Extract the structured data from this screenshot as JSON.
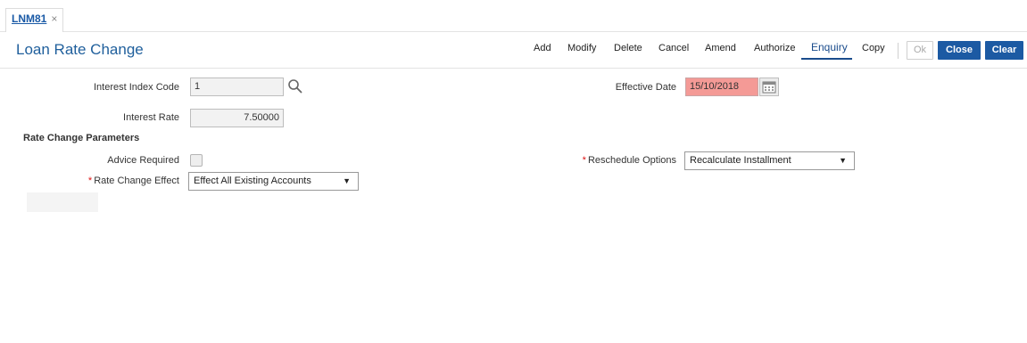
{
  "tab": {
    "label": "LNM81",
    "close": "×"
  },
  "header": {
    "title": "Loan Rate Change"
  },
  "toolbar": {
    "add": "Add",
    "modify": "Modify",
    "delete": "Delete",
    "cancel": "Cancel",
    "amend": "Amend",
    "authorize": "Authorize",
    "enquiry": "Enquiry",
    "copy": "Copy",
    "ok": "Ok",
    "close": "Close",
    "clear": "Clear"
  },
  "form": {
    "interest_index_code": {
      "label": "Interest Index Code",
      "value": "1"
    },
    "effective_date": {
      "label": "Effective Date",
      "value": "15/10/2018"
    },
    "interest_rate": {
      "label": "Interest Rate",
      "value": "7.50000"
    },
    "section_title": "Rate Change Parameters",
    "advice_required": {
      "label": "Advice Required",
      "checked": false
    },
    "reschedule_options": {
      "label": "Reschedule Options",
      "value": "Recalculate Installment",
      "required_mark": "*"
    },
    "rate_change_effect": {
      "label": "Rate Change Effect",
      "value": "Effect All Existing Accounts",
      "required_mark": "*"
    }
  },
  "colors": {
    "accent": "#1c5aa3",
    "title": "#1f5f9c",
    "date_error": "#f49a96"
  }
}
